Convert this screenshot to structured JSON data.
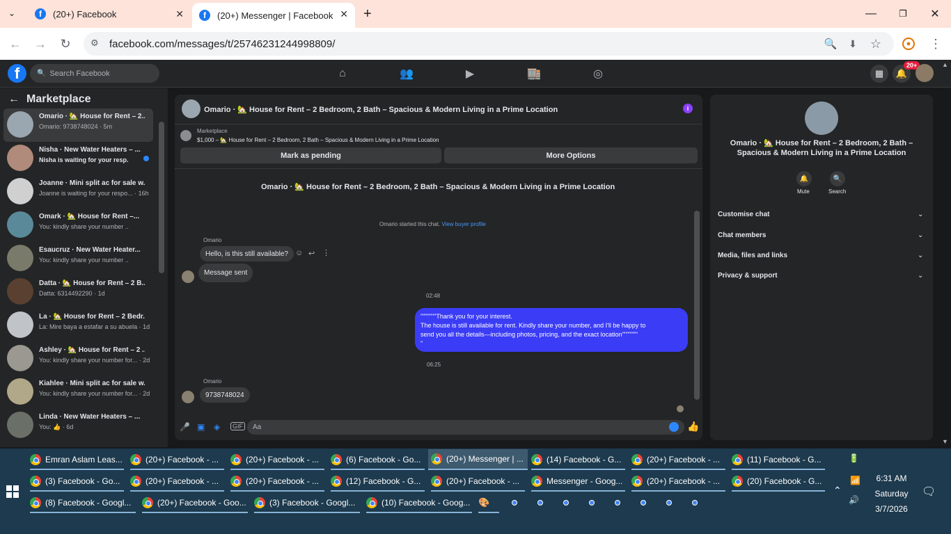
{
  "browser": {
    "tabs": [
      {
        "title": "(20+) Facebook"
      },
      {
        "title": "(20+) Messenger | Facebook"
      }
    ],
    "url": "facebook.com/messages/t/25746231244998809/"
  },
  "fb": {
    "search_placeholder": "Search Facebook",
    "notif_badge": "20+"
  },
  "left": {
    "title": "Marketplace",
    "conversations": [
      {
        "name": "Omario · 🏡 House for Rent – 2...",
        "preview": "Omario: 9738748024 · 5m"
      },
      {
        "name": "Nisha · New Water Heaters – ...",
        "preview": "Nisha is waiting for your resp... · 10h"
      },
      {
        "name": "Joanne · Mini split ac for sale w...",
        "preview": "Joanne is waiting for your respo... · 16h"
      },
      {
        "name": "Omark · 🏡 House for Rent –...",
        "preview": "You: kindly share your number ... · 1d"
      },
      {
        "name": "Esaucruz · New Water Heater...",
        "preview": "You: kindly share your number ... · 1d"
      },
      {
        "name": "Datta · 🏡 House for Rent – 2 B...",
        "preview": "Datta: 6314492290 · 1d"
      },
      {
        "name": "La · 🏡 House for Rent – 2 Bedr...",
        "preview": "La: Mire baya a estafar a su abuela · 1d"
      },
      {
        "name": "Ashley · 🏡 House for Rent – 2 ...",
        "preview": "You: kindly share your number for... · 2d"
      },
      {
        "name": "Kiahlee · Mini split ac for sale w...",
        "preview": "You: kindly share your number for... · 2d"
      },
      {
        "name": "Linda · New Water Heaters – ...",
        "preview": "You: 👍 · 6d"
      }
    ]
  },
  "chat": {
    "header_title": "Omario · 🏡 House for Rent – 2 Bedroom, 2 Bath – Spacious & Modern Living in a Prime Location",
    "marketplace_label": "Marketplace",
    "listing": "$1,000 – 🏡 House for Rent – 2 Bedroom, 2 Bath – Spacious & Modern Living in a Prime Location",
    "mark_pending": "Mark as pending",
    "more_options": "More Options",
    "thread_title": "Omario · 🏡 House for Rent – 2 Bedroom, 2 Bath – Spacious & Modern Living in a Prime Location",
    "started_text": "Omario started this chat.",
    "view_buyer": "View buyer profile",
    "sender1": "Omario",
    "msg1": "Hello, is this still available?",
    "msg2": "Message sent",
    "time1": "02:48",
    "out_line1": "\"\"\"\"\"\"\"Thank you for your interest.",
    "out_line2": "The house is still available for rent. Kindly share your number, and I'll be happy to",
    "out_line3": "send you all the details—including photos, pricing, and the exact location\"\"\"\"\"\"\"",
    "out_line4": "\"",
    "time2": "06:25",
    "sender2": "Omario",
    "msg3": "9738748024",
    "input_placeholder": "Aa"
  },
  "right": {
    "title_line1": "Omario · 🏡 House for Rent – 2 Bedroom, 2 Bath –",
    "title_line2": "Spacious & Modern Living in a Prime Location",
    "mute": "Mute",
    "search": "Search",
    "items": [
      "Customise chat",
      "Chat members",
      "Media, files and links",
      "Privacy & support"
    ]
  },
  "taskbar": {
    "row1": [
      "Emran Aslam Leas...",
      "(20+) Facebook - ...",
      "(20+) Facebook - ...",
      "(6) Facebook - Go...",
      "(20+) Messenger | ...",
      "(14) Facebook - G...",
      "(20+) Facebook - ...",
      "(11) Facebook - G..."
    ],
    "row2": [
      "(3) Facebook - Go...",
      "(20+) Facebook - ...",
      "(20+) Facebook - ...",
      "(12) Facebook - G...",
      "(20+) Facebook - ...",
      "Messenger - Goog...",
      "(20+) Facebook - ...",
      "(20) Facebook - G..."
    ],
    "row3": [
      "(8) Facebook - Googl...",
      "(20+) Facebook - Goo...",
      "(3) Facebook - Googl...",
      "(10) Facebook - Goog..."
    ],
    "time": "6:31 AM",
    "day": "Saturday",
    "date": "3/7/2026"
  }
}
